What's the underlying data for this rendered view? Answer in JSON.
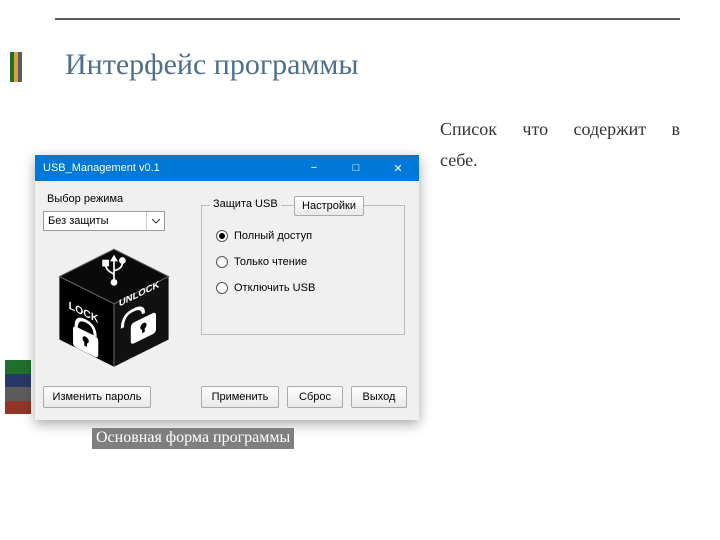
{
  "slide": {
    "title": "Интерфейс программы",
    "body_line1": "Список что содержит в",
    "body_line2": "себе.",
    "caption": "Основная форма программы"
  },
  "window": {
    "title": "USB_Management v0.1",
    "minimize": "−",
    "maximize": "□",
    "close": "✕",
    "mode_label": "Выбор режима",
    "mode_value": "Без защиты",
    "group_label": "Защита USB",
    "settings_button": "Настройки",
    "radios": {
      "full": "Полный доступ",
      "readonly": "Только чтение",
      "disable": "Отключить USB"
    },
    "buttons": {
      "change_password": "Изменить пароль",
      "apply": "Применить",
      "reset": "Сброс",
      "exit": "Выход"
    }
  }
}
